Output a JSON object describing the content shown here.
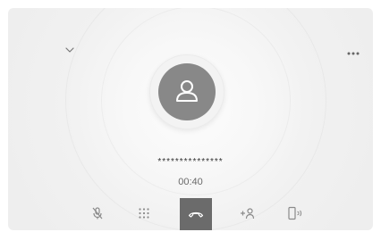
{
  "call": {
    "number": "***************",
    "duration": "00:40"
  },
  "icons": {
    "collapse": "chevron-down-icon",
    "more": "more-dots-icon",
    "contact": "person-icon",
    "mute": "mic-off-icon",
    "keypad": "keypad-icon",
    "end_call": "end-call-icon",
    "add_call": "add-person-icon",
    "audio_transfer": "phone-transfer-icon"
  },
  "colors": {
    "background": "#eeeeee",
    "avatar": "#888888",
    "end_call_button": "#6b6b6b",
    "icon": "#8a8a8a"
  }
}
